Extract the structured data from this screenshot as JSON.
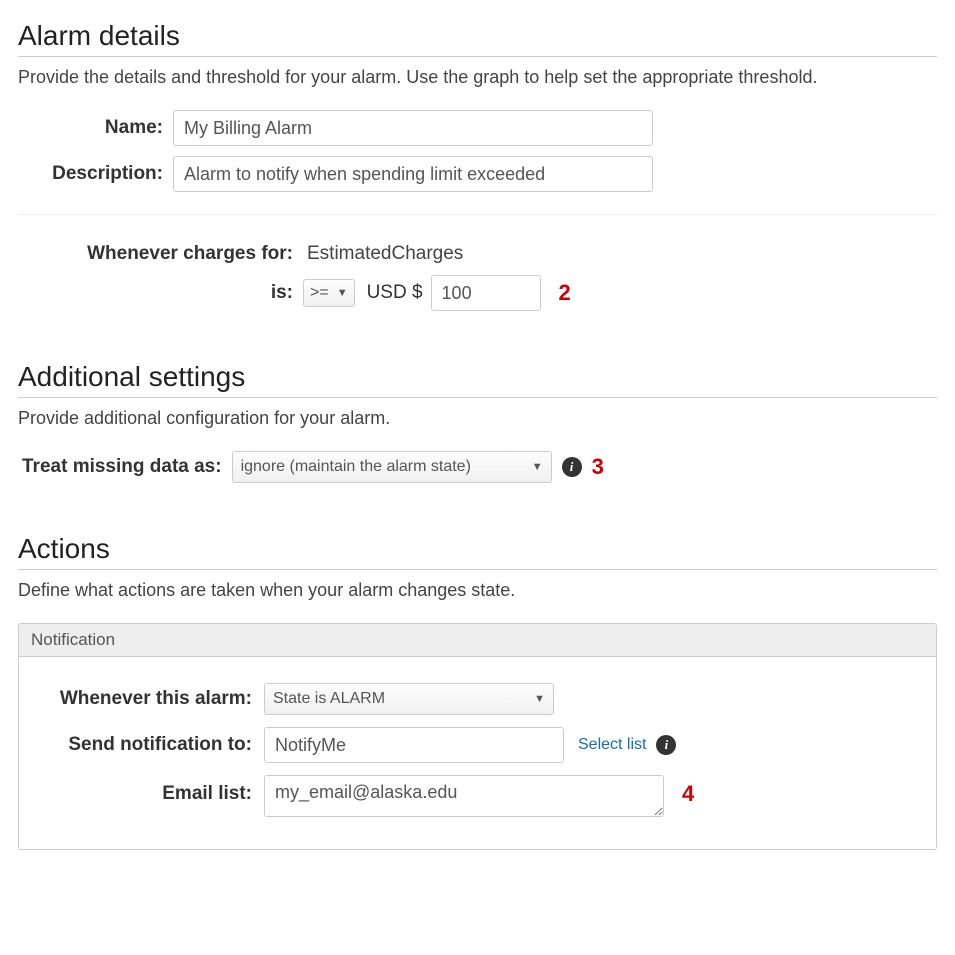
{
  "colors": {
    "callout": "#c00"
  },
  "details": {
    "heading": "Alarm details",
    "desc": "Provide the details and threshold for your alarm. Use the graph to help set the appropriate threshold.",
    "name_label": "Name:",
    "name_value": "My Billing Alarm",
    "description_label": "Description:",
    "description_value": "Alarm to notify when spending limit exceeded",
    "whenever_label": "Whenever charges for:",
    "metric_name": "EstimatedCharges",
    "is_label": "is:",
    "operator": ">=",
    "currency_label": "USD $",
    "amount": "100",
    "callout": "2"
  },
  "additional": {
    "heading": "Additional settings",
    "desc": "Provide additional configuration for your alarm.",
    "treat_label": "Treat missing data as:",
    "treat_value": "ignore (maintain the alarm state)",
    "callout": "3"
  },
  "actions": {
    "heading": "Actions",
    "desc": "Define what actions are taken when your alarm changes state.",
    "panel_title": "Notification",
    "whenever_label": "Whenever this alarm:",
    "state_value": "State is ALARM",
    "send_to_label": "Send notification to:",
    "topic_value": "NotifyMe",
    "select_list_link": "Select list",
    "email_label": "Email list:",
    "email_value": "my_email@alaska.edu",
    "callout": "4"
  }
}
